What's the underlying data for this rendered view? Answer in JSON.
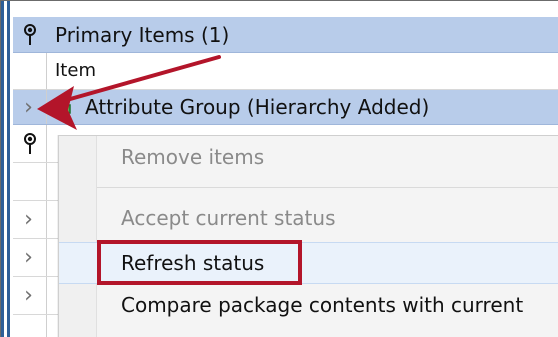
{
  "grid": {
    "group_title": "Primary Items (1)",
    "column_header": "Item",
    "selected_row_label": "Attribute Group (Hierarchy Added)"
  },
  "context_menu": {
    "items": [
      {
        "label": "Remove items",
        "enabled": false
      },
      {
        "label": "Accept current status",
        "enabled": false
      },
      {
        "label": "Refresh status",
        "enabled": true,
        "hovered": true,
        "highlighted": true
      },
      {
        "label": "Compare package contents with current",
        "enabled": true
      }
    ]
  },
  "icons": {
    "pin": "pin-icon",
    "chevron": "chevron-right-icon",
    "folder": "folder-icon",
    "arrow": "annotation-arrow"
  },
  "colors": {
    "selection_blue": "#b8ccea",
    "annotation_red": "#b3152a",
    "folder_green": "#39b54a",
    "rail_blue": "#2f5f98"
  }
}
